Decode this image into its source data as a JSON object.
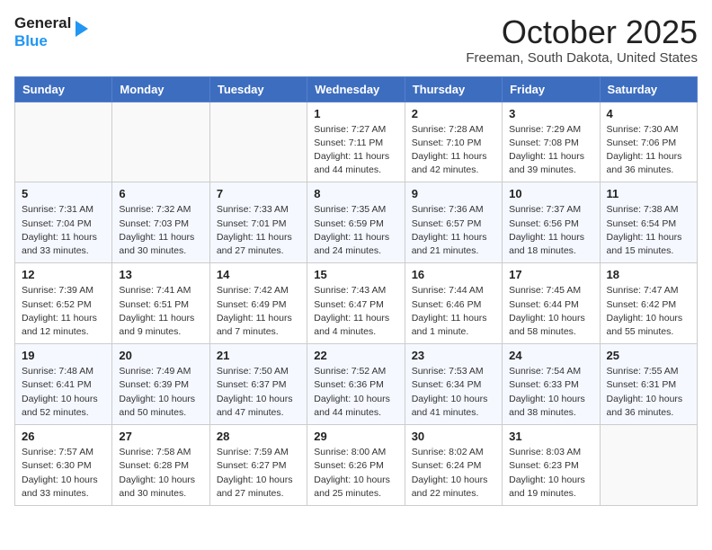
{
  "header": {
    "logo_line1": "General",
    "logo_line2": "Blue",
    "month": "October 2025",
    "location": "Freeman, South Dakota, United States"
  },
  "weekdays": [
    "Sunday",
    "Monday",
    "Tuesday",
    "Wednesday",
    "Thursday",
    "Friday",
    "Saturday"
  ],
  "weeks": [
    [
      {
        "day": "",
        "info": ""
      },
      {
        "day": "",
        "info": ""
      },
      {
        "day": "",
        "info": ""
      },
      {
        "day": "1",
        "info": "Sunrise: 7:27 AM\nSunset: 7:11 PM\nDaylight: 11 hours and 44 minutes."
      },
      {
        "day": "2",
        "info": "Sunrise: 7:28 AM\nSunset: 7:10 PM\nDaylight: 11 hours and 42 minutes."
      },
      {
        "day": "3",
        "info": "Sunrise: 7:29 AM\nSunset: 7:08 PM\nDaylight: 11 hours and 39 minutes."
      },
      {
        "day": "4",
        "info": "Sunrise: 7:30 AM\nSunset: 7:06 PM\nDaylight: 11 hours and 36 minutes."
      }
    ],
    [
      {
        "day": "5",
        "info": "Sunrise: 7:31 AM\nSunset: 7:04 PM\nDaylight: 11 hours and 33 minutes."
      },
      {
        "day": "6",
        "info": "Sunrise: 7:32 AM\nSunset: 7:03 PM\nDaylight: 11 hours and 30 minutes."
      },
      {
        "day": "7",
        "info": "Sunrise: 7:33 AM\nSunset: 7:01 PM\nDaylight: 11 hours and 27 minutes."
      },
      {
        "day": "8",
        "info": "Sunrise: 7:35 AM\nSunset: 6:59 PM\nDaylight: 11 hours and 24 minutes."
      },
      {
        "day": "9",
        "info": "Sunrise: 7:36 AM\nSunset: 6:57 PM\nDaylight: 11 hours and 21 minutes."
      },
      {
        "day": "10",
        "info": "Sunrise: 7:37 AM\nSunset: 6:56 PM\nDaylight: 11 hours and 18 minutes."
      },
      {
        "day": "11",
        "info": "Sunrise: 7:38 AM\nSunset: 6:54 PM\nDaylight: 11 hours and 15 minutes."
      }
    ],
    [
      {
        "day": "12",
        "info": "Sunrise: 7:39 AM\nSunset: 6:52 PM\nDaylight: 11 hours and 12 minutes."
      },
      {
        "day": "13",
        "info": "Sunrise: 7:41 AM\nSunset: 6:51 PM\nDaylight: 11 hours and 9 minutes."
      },
      {
        "day": "14",
        "info": "Sunrise: 7:42 AM\nSunset: 6:49 PM\nDaylight: 11 hours and 7 minutes."
      },
      {
        "day": "15",
        "info": "Sunrise: 7:43 AM\nSunset: 6:47 PM\nDaylight: 11 hours and 4 minutes."
      },
      {
        "day": "16",
        "info": "Sunrise: 7:44 AM\nSunset: 6:46 PM\nDaylight: 11 hours and 1 minute."
      },
      {
        "day": "17",
        "info": "Sunrise: 7:45 AM\nSunset: 6:44 PM\nDaylight: 10 hours and 58 minutes."
      },
      {
        "day": "18",
        "info": "Sunrise: 7:47 AM\nSunset: 6:42 PM\nDaylight: 10 hours and 55 minutes."
      }
    ],
    [
      {
        "day": "19",
        "info": "Sunrise: 7:48 AM\nSunset: 6:41 PM\nDaylight: 10 hours and 52 minutes."
      },
      {
        "day": "20",
        "info": "Sunrise: 7:49 AM\nSunset: 6:39 PM\nDaylight: 10 hours and 50 minutes."
      },
      {
        "day": "21",
        "info": "Sunrise: 7:50 AM\nSunset: 6:37 PM\nDaylight: 10 hours and 47 minutes."
      },
      {
        "day": "22",
        "info": "Sunrise: 7:52 AM\nSunset: 6:36 PM\nDaylight: 10 hours and 44 minutes."
      },
      {
        "day": "23",
        "info": "Sunrise: 7:53 AM\nSunset: 6:34 PM\nDaylight: 10 hours and 41 minutes."
      },
      {
        "day": "24",
        "info": "Sunrise: 7:54 AM\nSunset: 6:33 PM\nDaylight: 10 hours and 38 minutes."
      },
      {
        "day": "25",
        "info": "Sunrise: 7:55 AM\nSunset: 6:31 PM\nDaylight: 10 hours and 36 minutes."
      }
    ],
    [
      {
        "day": "26",
        "info": "Sunrise: 7:57 AM\nSunset: 6:30 PM\nDaylight: 10 hours and 33 minutes."
      },
      {
        "day": "27",
        "info": "Sunrise: 7:58 AM\nSunset: 6:28 PM\nDaylight: 10 hours and 30 minutes."
      },
      {
        "day": "28",
        "info": "Sunrise: 7:59 AM\nSunset: 6:27 PM\nDaylight: 10 hours and 27 minutes."
      },
      {
        "day": "29",
        "info": "Sunrise: 8:00 AM\nSunset: 6:26 PM\nDaylight: 10 hours and 25 minutes."
      },
      {
        "day": "30",
        "info": "Sunrise: 8:02 AM\nSunset: 6:24 PM\nDaylight: 10 hours and 22 minutes."
      },
      {
        "day": "31",
        "info": "Sunrise: 8:03 AM\nSunset: 6:23 PM\nDaylight: 10 hours and 19 minutes."
      },
      {
        "day": "",
        "info": ""
      }
    ]
  ]
}
